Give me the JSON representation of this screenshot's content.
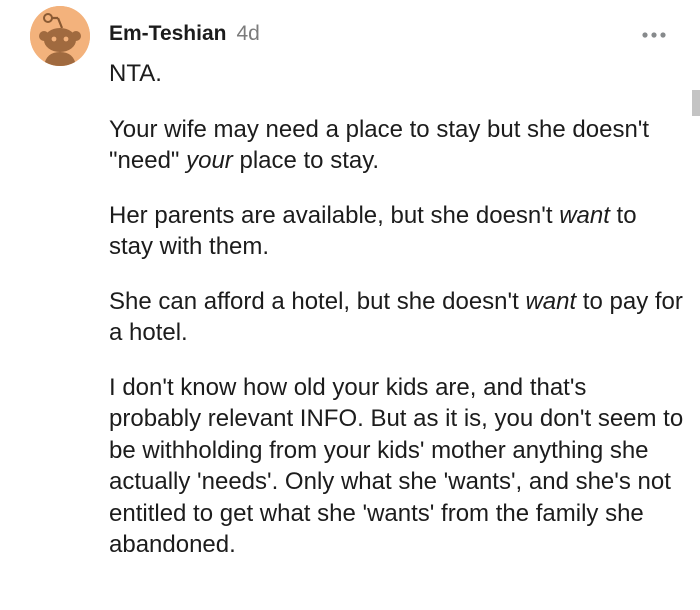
{
  "comment": {
    "username": "Em-Teshian",
    "timestamp": "4d",
    "avatar_icon": "snoo-avatar-icon",
    "more_icon": "more-options-icon",
    "avatar_color": "#f3b27c",
    "paragraphs": [
      [
        {
          "t": "NTA."
        }
      ],
      [
        {
          "t": "Your wife may need a place to stay but she doesn't \"need\" "
        },
        {
          "t": "your",
          "em": true
        },
        {
          "t": " place to stay."
        }
      ],
      [
        {
          "t": "Her parents are available, but she doesn't "
        },
        {
          "t": "want",
          "em": true
        },
        {
          "t": " to stay with them."
        }
      ],
      [
        {
          "t": "She can afford a hotel, but she doesn't "
        },
        {
          "t": "want",
          "em": true
        },
        {
          "t": " to pay for a hotel."
        }
      ],
      [
        {
          "t": "I don't know how old your kids are, and that's probably relevant INFO. But as it is, you don't seem to be withholding from your kids' mother anything she actually 'needs'. Only what she 'wants', and she's not entitled to get what she 'wants' from the family she abandoned."
        }
      ]
    ]
  }
}
